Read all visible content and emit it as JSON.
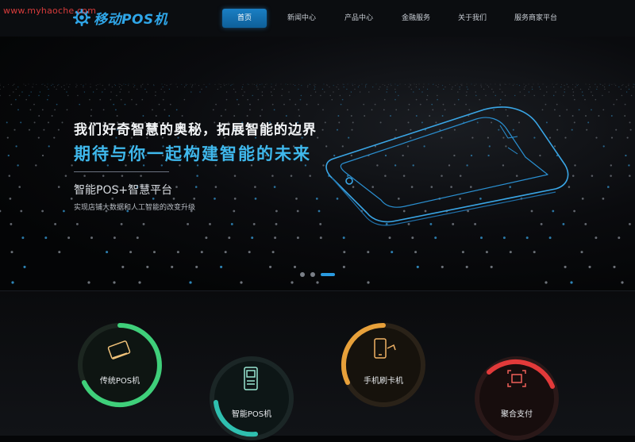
{
  "watermark": "www.myhaoche.com",
  "logo": {
    "text": "移动POS机",
    "icon": "gear-icon"
  },
  "nav": {
    "items": [
      {
        "label": "首页",
        "active": true
      },
      {
        "label": "新闻中心",
        "active": false
      },
      {
        "label": "产品中心",
        "active": false
      },
      {
        "label": "金融服务",
        "active": false
      },
      {
        "label": "关于我们",
        "active": false
      },
      {
        "label": "服务商家平台",
        "active": false
      }
    ]
  },
  "hero": {
    "line1": "我们好奇智慧的奥秘，拓展智能的边界",
    "line2": "期待与你一起构建智能的未来",
    "line3": "智能POS+智慧平台",
    "line4": "实现店铺大数据和人工智能的改变升级",
    "image": "pos-terminal-outline",
    "slide_count": 3,
    "active_slide": 3
  },
  "services": [
    {
      "label": "传统POS机",
      "icon": "card-swipe-icon",
      "color": "#3fcf7a"
    },
    {
      "label": "智能POS机",
      "icon": "pos-terminal-icon",
      "color": "#2fc0b0"
    },
    {
      "label": "手机刷卡机",
      "icon": "phone-card-icon",
      "color": "#e7a03a"
    },
    {
      "label": "聚合支付",
      "icon": "scan-code-icon",
      "color": "#e23a3a"
    }
  ],
  "colors": {
    "accent": "#2a9be0",
    "highlight": "#3fb8ec",
    "background": "#050608"
  }
}
